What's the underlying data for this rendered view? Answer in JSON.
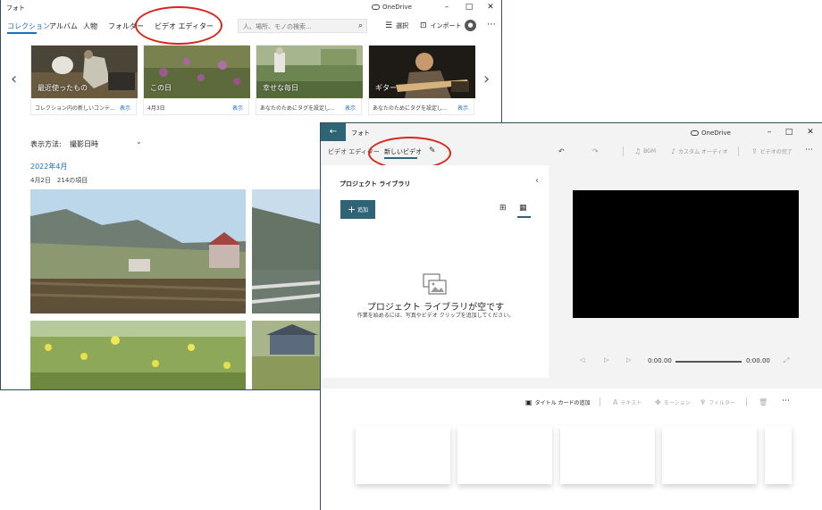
{
  "photos_window": {
    "title": "フォト",
    "onedrive_label": "OneDrive",
    "nav": [
      "コレクション",
      "アルバム",
      "人物",
      "フォルダー",
      "ビデオ エディター"
    ],
    "search": {
      "placeholder": "人、場所、モノの検索..."
    },
    "toolbar": {
      "select": "選択",
      "import": "インポート"
    },
    "cards": [
      {
        "title": "最近使ったもの",
        "desc": "コレクション内の新しいコンテ...",
        "action": "表示"
      },
      {
        "title": "この日",
        "desc": "4月3日",
        "action": "表示"
      },
      {
        "title": "幸せな毎日",
        "desc": "あなたのためにタグを設定し...",
        "action": "表示"
      },
      {
        "title": "ギター",
        "desc": "あなたのためにタグを設定し...",
        "action": "表示"
      }
    ],
    "view": {
      "label": "表示方法:",
      "value": "撮影日時"
    },
    "month": "2022年4月",
    "day_count": "4月2日　214の項目"
  },
  "editor_window": {
    "title": "フォト",
    "onedrive_label": "OneDrive",
    "breadcrumb": {
      "parent": "ビデオ エディター",
      "current": "新しいビデオ"
    },
    "toolbar": {
      "bgm": "BGM",
      "custom_audio": "カスタム オーディオ",
      "finish": "ビデオの完了"
    },
    "library": {
      "title": "プロジェクト ライブラリ",
      "add": "追加",
      "empty_title": "プロジェクト ライブラリが空です",
      "empty_sub": "作業を始めるには、写真やビデオ クリップを追加してください。"
    },
    "player": {
      "time_current": "0:00.00",
      "time_total": "0:00.00"
    },
    "storyboard": {
      "title_card": "タイトル カードの追加",
      "text": "テキスト",
      "motion": "モーション",
      "filter": "フィルター"
    }
  },
  "colors": {
    "accent": "#1d6fb8",
    "editor_accent": "#2e6475",
    "highlight": "#d9261c"
  }
}
